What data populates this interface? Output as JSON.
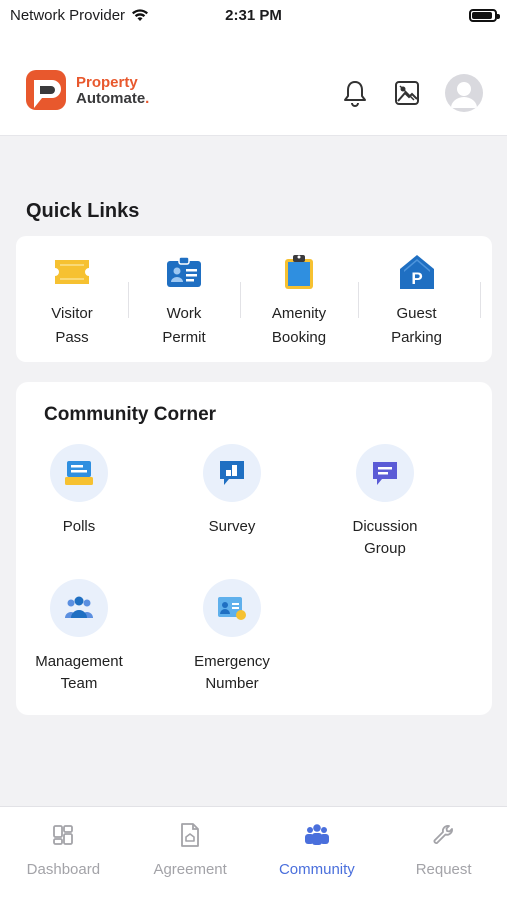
{
  "status_bar": {
    "carrier": "Network Provider",
    "time": "2:31 PM",
    "battery_level": 0.9
  },
  "header": {
    "logo_line1": "Property",
    "logo_line2": "Automate",
    "logo_dot": ".",
    "icons": [
      "bell-icon",
      "image-icon",
      "avatar"
    ]
  },
  "quick_links": {
    "title": "Quick Links",
    "items": [
      {
        "line1": "Visitor",
        "line2": "Pass",
        "icon": "ticket-icon"
      },
      {
        "line1": "Work",
        "line2": "Permit",
        "icon": "id-card-icon"
      },
      {
        "line1": "Amenity",
        "line2": "Booking",
        "icon": "clipboard-icon"
      },
      {
        "line1": "Guest",
        "line2": "Parking",
        "icon": "parking-icon"
      }
    ]
  },
  "community_corner": {
    "title": "Community Corner",
    "items": [
      {
        "line1": "Polls",
        "line2": "",
        "icon": "polls-icon"
      },
      {
        "line1": "Survey",
        "line2": "",
        "icon": "survey-icon"
      },
      {
        "line1": "Dicussion",
        "line2": "Group",
        "icon": "chat-icon"
      },
      {
        "line1": "Management",
        "line2": "Team",
        "icon": "team-icon"
      },
      {
        "line1": "Emergency",
        "line2": "Number",
        "icon": "contact-card-icon"
      }
    ]
  },
  "bottom_nav": {
    "items": [
      {
        "label": "Dashboard",
        "icon": "dashboard-icon",
        "active": false
      },
      {
        "label": "Agreement",
        "icon": "document-icon",
        "active": false
      },
      {
        "label": "Community",
        "icon": "people-icon",
        "active": true
      },
      {
        "label": "Request",
        "icon": "wrench-icon",
        "active": false
      }
    ]
  },
  "colors": {
    "brand_orange": "#e8582d",
    "accent_blue": "#4a6fdc",
    "icon_blue": "#1f6fc2",
    "background": "#f2f2f4"
  }
}
